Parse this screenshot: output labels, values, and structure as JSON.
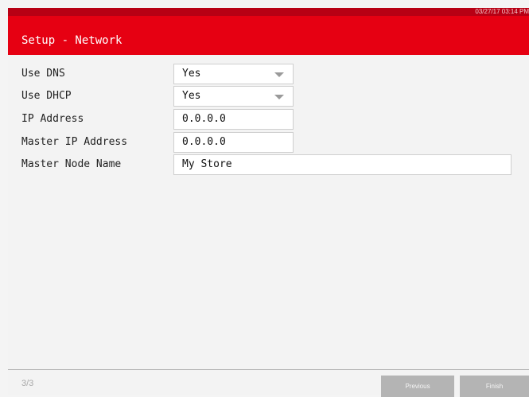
{
  "status": {
    "datetime": "03/27/17 03:14 PM"
  },
  "header": {
    "title": "Setup - Network"
  },
  "form": {
    "rows": [
      {
        "label": "Use DNS",
        "value": "Yes"
      },
      {
        "label": "Use DHCP",
        "value": "Yes"
      },
      {
        "label": "IP Address",
        "value": "0.0.0.0"
      },
      {
        "label": "Master IP Address",
        "value": "0.0.0.0"
      },
      {
        "label": "Master Node Name",
        "value": "My Store"
      }
    ]
  },
  "footer": {
    "page_indicator": "3/3",
    "previous_label": "Previous",
    "finish_label": "Finish"
  },
  "icons": {
    "dropdown": "chevron-down-icon"
  },
  "colors": {
    "header": "#e60012",
    "status_strip": "#b80014",
    "button": "#b4b4b4"
  }
}
